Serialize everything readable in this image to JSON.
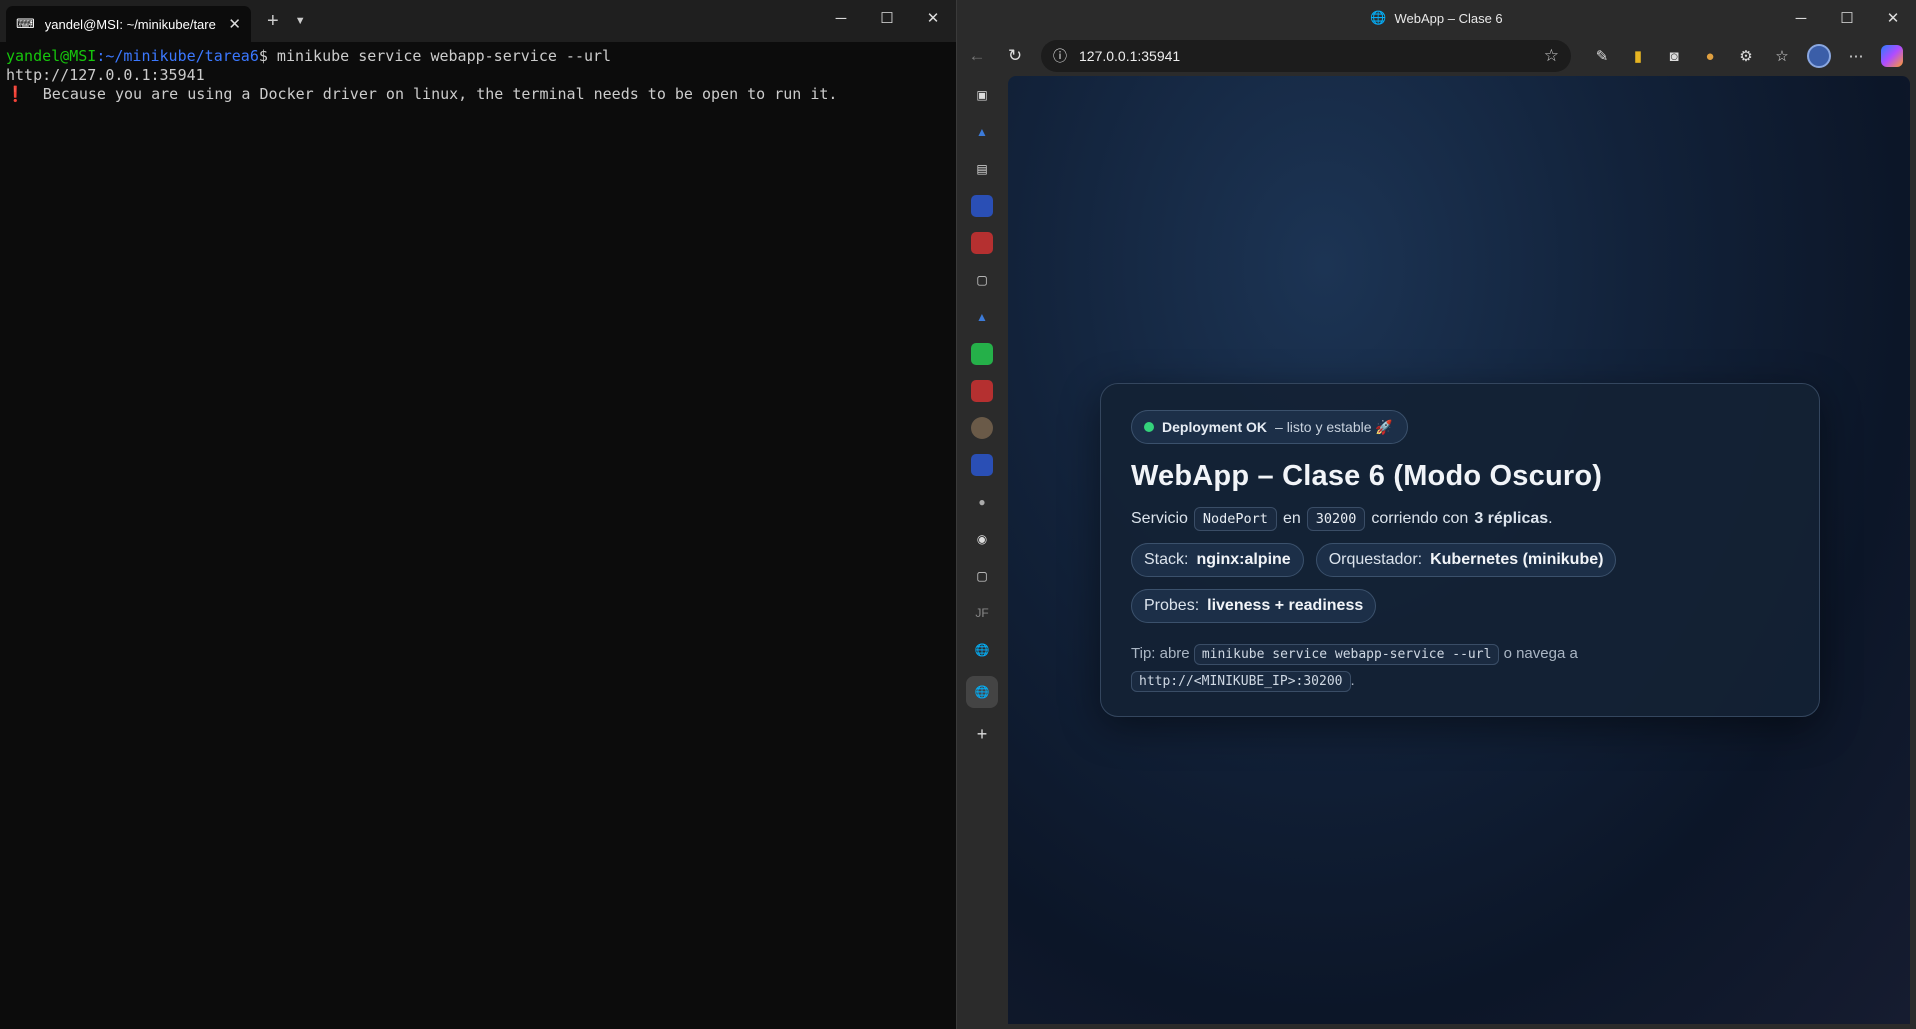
{
  "terminal": {
    "tab_title": "yandel@MSI: ~/minikube/tare",
    "prompt_user": "yandel@MSI",
    "prompt_path": ":~/minikube/tarea6",
    "prompt_symbol": "$",
    "command": " minikube service webapp-service --url",
    "output_url": "http://127.0.0.1:35941",
    "warning_icon": "❗",
    "warning_text": "  Because you are using a Docker driver on linux, the terminal needs to be open to run it."
  },
  "browser": {
    "window_title": "WebApp – Clase 6",
    "address": "127.0.0.1:35941",
    "sidebar_icons": [
      "vertical-tabs-icon",
      "azure-icon",
      "collections-icon",
      "app-icon",
      "pdf-icon",
      "document-icon",
      "azure-icon",
      "whatsapp-icon",
      "pdf-icon",
      "app-icon",
      "app-icon",
      "app-icon",
      "github-icon",
      "document-icon",
      "jf-icon",
      "globe-icon",
      "globe-icon",
      "add-icon"
    ],
    "jf_label": "JF"
  },
  "page": {
    "badge_strong": "Deployment OK",
    "badge_rest": "– listo y estable 🚀",
    "title": "WebApp – Clase 6 (Modo Oscuro)",
    "desc_1": "Servicio",
    "desc_code_1": "NodePort",
    "desc_2": "en",
    "desc_code_2": "30200",
    "desc_3": "corriendo con",
    "desc_strong": "3 réplicas",
    "desc_end": ".",
    "pill_stack_label": "Stack:",
    "pill_stack_value": "nginx:alpine",
    "pill_orq_label": "Orquestador:",
    "pill_orq_value": "Kubernetes (minikube)",
    "pill_probes_label": "Probes:",
    "pill_probes_value": "liveness + readiness",
    "tip_1": "Tip: abre",
    "tip_code_1": "minikube service webapp-service --url",
    "tip_2": "o navega a",
    "tip_code_2": "http://<MINIKUBE_IP>:30200",
    "tip_end": "."
  },
  "colors": {
    "accent_green": "#34d27b",
    "prompt_green": "#16c60c",
    "prompt_blue": "#3b78ff"
  }
}
